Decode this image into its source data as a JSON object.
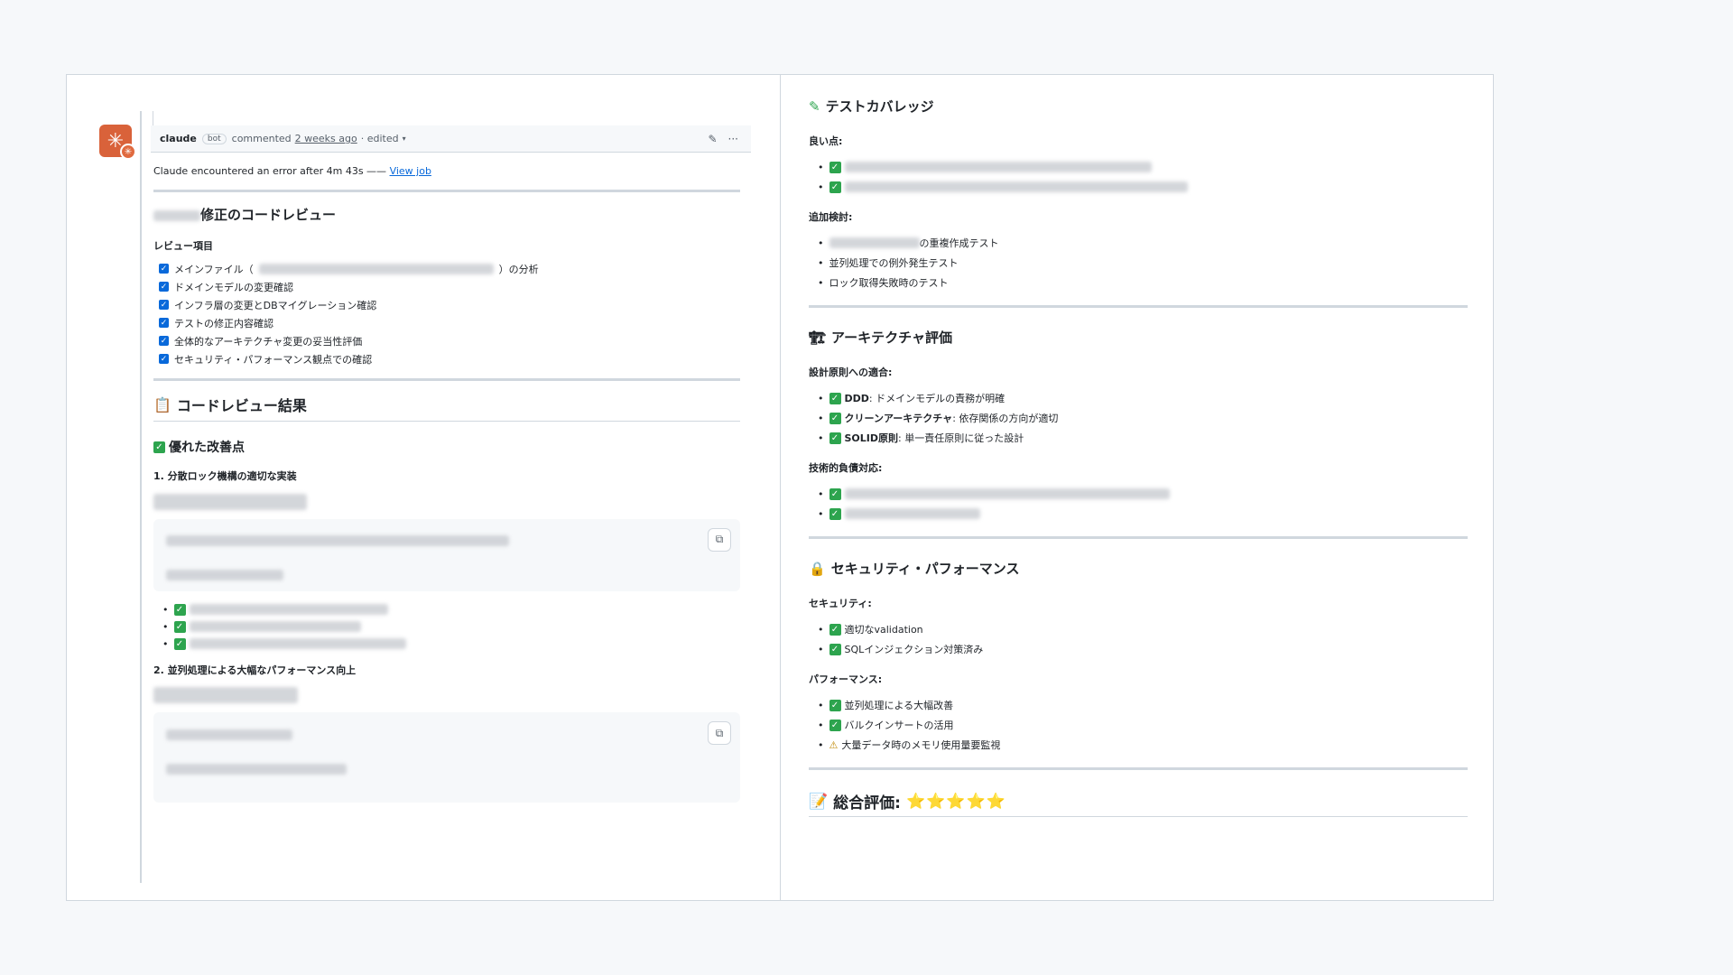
{
  "comment": {
    "author": "claude",
    "badge": "bot",
    "action": "commented",
    "time": "2 weeks ago",
    "edited": "· edited",
    "error_text": "Claude encountered an error after 4m 43s —— ",
    "view_job": "View job"
  },
  "review": {
    "title": "修正のコードレビュー",
    "items_heading": "レビュー項目",
    "checklist": [
      {
        "prefix": "メインファイル（",
        "suffix": "）の分析"
      },
      {
        "prefix": "ドメインモデルの変更確認",
        "suffix": ""
      },
      {
        "prefix": "インフラ層の変更とDBマイグレーション確認",
        "suffix": ""
      },
      {
        "prefix": "テストの修正内容確認",
        "suffix": ""
      },
      {
        "prefix": "全体的なアーキテクチャ変更の妥当性評価",
        "suffix": ""
      },
      {
        "prefix": "セキュリティ・パフォーマンス観点での確認",
        "suffix": ""
      }
    ],
    "result_heading": "コードレビュー結果",
    "good_heading": "優れた改善点",
    "point1": "1. 分散ロック機構の適切な実装",
    "point2": "2. 並列処理による大幅なパフォーマンス向上"
  },
  "right": {
    "test_heading": "テストカバレッジ",
    "good": "良い点:",
    "additional": "追加検討:",
    "additional_items": [
      "の重複作成テスト",
      "並列処理での例外発生テスト",
      "ロック取得失敗時のテスト"
    ],
    "arch_heading": "アーキテクチャ評価",
    "design_heading": "設計原則への適合:",
    "design_items": [
      {
        "bold": "DDD",
        "text": ": ドメインモデルの責務が明確"
      },
      {
        "bold": "クリーンアーキテクチャ",
        "text": ": 依存関係の方向が適切"
      },
      {
        "bold": "SOLID原則",
        "text": ": 単一責任原則に従った設計"
      }
    ],
    "debt_heading": "技術的負債対応:",
    "sec_heading": "セキュリティ・パフォーマンス",
    "security": "セキュリティ:",
    "security_items": [
      "適切なvalidation",
      "SQLインジェクション対策済み"
    ],
    "performance": "パフォーマンス:",
    "performance_items": [
      "並列処理による大幅改善",
      "バルクインサートの活用"
    ],
    "performance_warning": "大量データ時のメモリ使用量要監視",
    "total_heading": "総合評価:",
    "stars": "⭐⭐⭐⭐⭐"
  }
}
